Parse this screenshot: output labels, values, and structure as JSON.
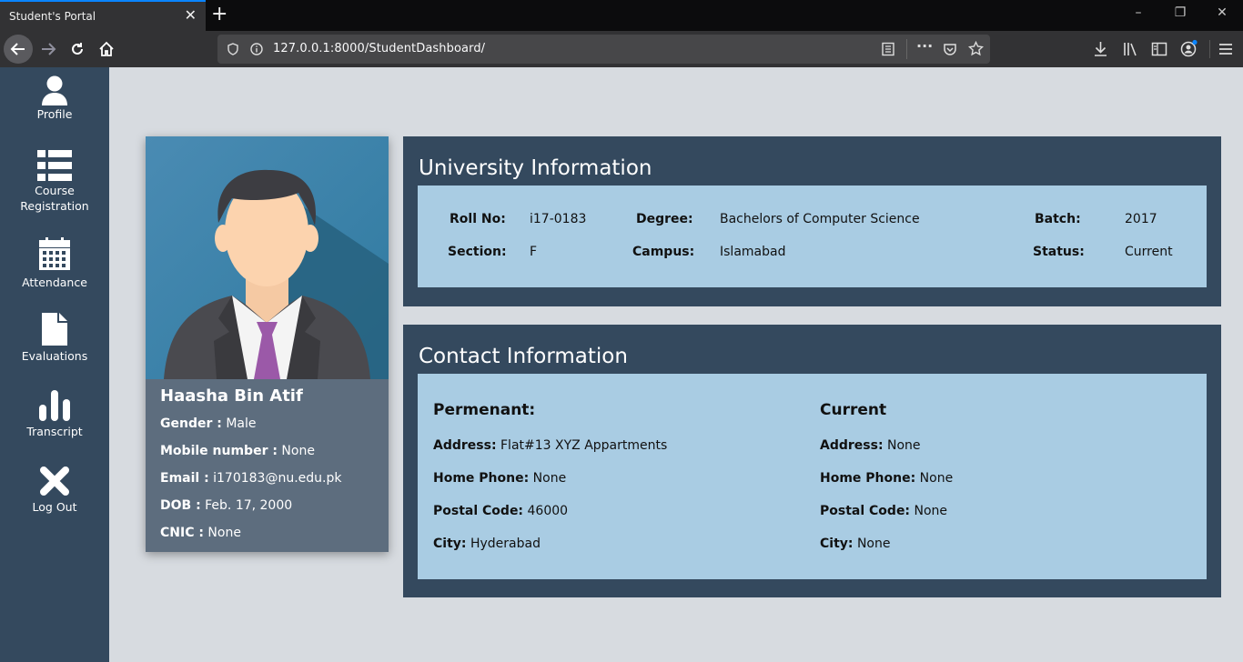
{
  "browser": {
    "tab_title": "Student's Portal",
    "url": "127.0.0.1:8000/StudentDashboard/"
  },
  "sidebar": {
    "items": [
      {
        "label": "Profile",
        "icon": "user-icon"
      },
      {
        "label": "Course Registration",
        "icon": "list-icon"
      },
      {
        "label": "Attendance",
        "icon": "calendar-icon"
      },
      {
        "label": "Evaluations",
        "icon": "document-icon"
      },
      {
        "label": "Transcript",
        "icon": "bar-chart-icon"
      },
      {
        "label": "Log Out",
        "icon": "close-icon"
      }
    ]
  },
  "profile": {
    "name": "Haasha Bin Atif",
    "gender_label": "Gender :",
    "gender": "Male",
    "mobile_label": "Mobile number :",
    "mobile": "None",
    "email_label": "Email :",
    "email": "i170183@nu.edu.pk",
    "dob_label": "DOB :",
    "dob": "Feb. 17, 2000",
    "cnic_label": "CNIC :",
    "cnic": "None"
  },
  "university": {
    "title": "University Information",
    "roll_label": "Roll No:",
    "roll": "i17-0183",
    "degree_label": "Degree:",
    "degree": "Bachelors of Computer Science",
    "batch_label": "Batch:",
    "batch": "2017",
    "section_label": "Section:",
    "section": "F",
    "campus_label": "Campus:",
    "campus": "Islamabad",
    "status_label": "Status:",
    "status": "Current"
  },
  "contact": {
    "title": "Contact Information",
    "permanent": {
      "heading": "Permenant:",
      "address_label": "Address:",
      "address": "Flat#13 XYZ Appartments",
      "phone_label": "Home Phone:",
      "phone": "None",
      "postal_label": "Postal Code:",
      "postal": "46000",
      "city_label": "City:",
      "city": "Hyderabad"
    },
    "current": {
      "heading": "Current",
      "address_label": "Address:",
      "address": "None",
      "phone_label": "Home Phone:",
      "phone": "None",
      "postal_label": "Postal Code:",
      "postal": "None",
      "city_label": "City:",
      "city": "None"
    }
  },
  "colors": {
    "sidebar": "#34495e",
    "panel": "#34495e",
    "panel_inner": "#a9cce3",
    "card": "#5d6d7e",
    "page_bg": "#d7dbe0"
  }
}
